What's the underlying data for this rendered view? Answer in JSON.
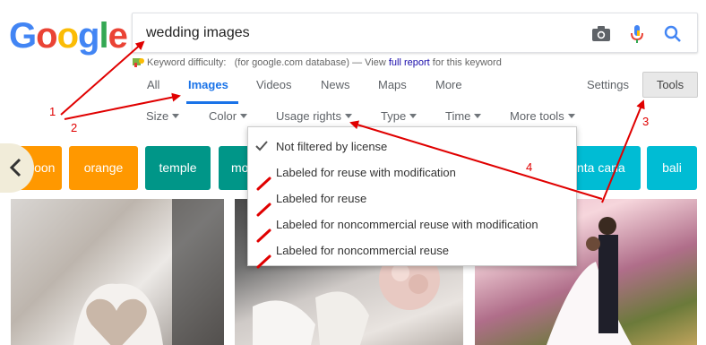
{
  "logo": {
    "letters": [
      "G",
      "o",
      "o",
      "g",
      "l",
      "e"
    ],
    "text": "Google"
  },
  "search": {
    "query": "wedding images"
  },
  "icons": {
    "camera": "camera-icon",
    "mic": "microphone-icon",
    "search": "search-icon",
    "keyword": "keyword-difficulty-icon",
    "check": "check-icon",
    "back": "chevron-left-icon"
  },
  "keyword_bar": {
    "label": "Keyword difficulty:",
    "middle": "(for google.com database) — View",
    "link": "full report",
    "tail": "for this keyword"
  },
  "tabs": [
    {
      "label": "All",
      "active": false
    },
    {
      "label": "Images",
      "active": true
    },
    {
      "label": "Videos",
      "active": false
    },
    {
      "label": "News",
      "active": false
    },
    {
      "label": "Maps",
      "active": false
    },
    {
      "label": "More",
      "active": false
    }
  ],
  "settings_label": "Settings",
  "tools_label": "Tools",
  "tools_row": [
    "Size",
    "Color",
    "Usage rights",
    "Type",
    "Time",
    "More tools"
  ],
  "usage_rights_menu": [
    {
      "label": "Not filtered by license",
      "selected": true
    },
    {
      "label": "Labeled for reuse with modification",
      "selected": false
    },
    {
      "label": "Labeled for reuse",
      "selected": false
    },
    {
      "label": "Labeled for noncommercial reuse with modification",
      "selected": false
    },
    {
      "label": "Labeled for noncommercial reuse",
      "selected": false
    }
  ],
  "chips": [
    {
      "label": "maroon",
      "color": "#ff9800"
    },
    {
      "label": "orange",
      "color": "#ff9800"
    },
    {
      "label": "temple",
      "color": "#009688"
    },
    {
      "label": "mo",
      "color": "#009688"
    },
    {
      "label": "nta cana",
      "color": "#00bcd4"
    },
    {
      "label": "bali",
      "color": "#00bcd4"
    }
  ],
  "annotations": [
    "1",
    "2",
    "3",
    "4"
  ],
  "colors": {
    "accent_blue": "#1a73e8",
    "annotation_red": "#e00000",
    "link": "#1a0dab"
  }
}
